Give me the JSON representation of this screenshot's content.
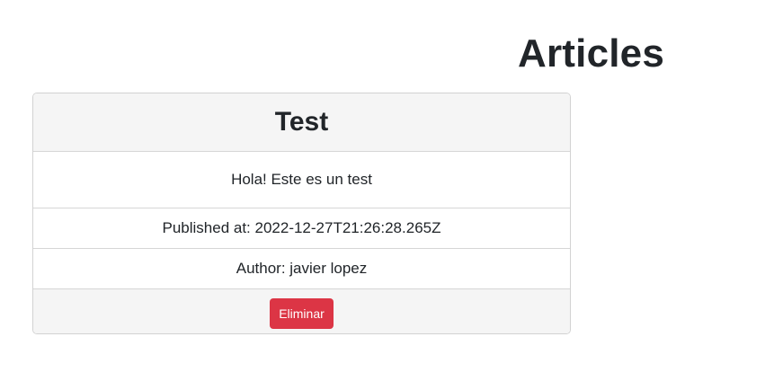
{
  "page": {
    "title": "Articles"
  },
  "article": {
    "title": "Test",
    "body": "Hola! Este es un test",
    "published": "Published at: 2022-12-27T21:26:28.265Z",
    "author": "Author: javier lopez",
    "delete_label": "Eliminar"
  },
  "colors": {
    "danger": "#dc3545",
    "card_header_bg": "#f5f5f5",
    "border": "#d6d6d6"
  }
}
